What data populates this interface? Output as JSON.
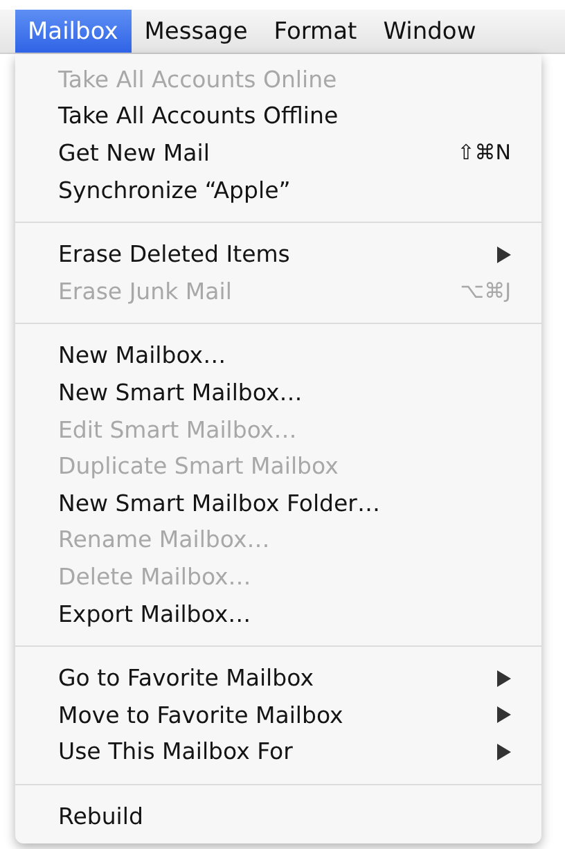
{
  "menubar": [
    {
      "label": "Mailbox",
      "selected": true
    },
    {
      "label": "Message",
      "selected": false
    },
    {
      "label": "Format",
      "selected": false
    },
    {
      "label": "Window",
      "selected": false
    }
  ],
  "menu": {
    "groups": [
      [
        {
          "label": "Take All Accounts Online",
          "disabled": true,
          "submenu": false
        },
        {
          "label": "Take All Accounts Offline",
          "disabled": false,
          "submenu": false
        },
        {
          "label": "Get New Mail",
          "disabled": false,
          "submenu": false,
          "shortcut": "⇧⌘N"
        },
        {
          "label": "Synchronize “Apple”",
          "disabled": false,
          "submenu": false
        }
      ],
      [
        {
          "label": "Erase Deleted Items",
          "disabled": false,
          "submenu": true
        },
        {
          "label": "Erase Junk Mail",
          "disabled": true,
          "submenu": false,
          "shortcut": "⌥⌘J"
        }
      ],
      [
        {
          "label": "New Mailbox…",
          "disabled": false,
          "submenu": false
        },
        {
          "label": "New Smart Mailbox…",
          "disabled": false,
          "submenu": false
        },
        {
          "label": "Edit Smart Mailbox…",
          "disabled": true,
          "submenu": false
        },
        {
          "label": "Duplicate Smart Mailbox",
          "disabled": true,
          "submenu": false
        },
        {
          "label": "New Smart Mailbox Folder…",
          "disabled": false,
          "submenu": false
        },
        {
          "label": "Rename Mailbox…",
          "disabled": true,
          "submenu": false
        },
        {
          "label": "Delete Mailbox…",
          "disabled": true,
          "submenu": false
        },
        {
          "label": "Export Mailbox…",
          "disabled": false,
          "submenu": false
        }
      ],
      [
        {
          "label": "Go to Favorite Mailbox",
          "disabled": false,
          "submenu": true
        },
        {
          "label": "Move to Favorite Mailbox",
          "disabled": false,
          "submenu": true
        },
        {
          "label": "Use This Mailbox For",
          "disabled": false,
          "submenu": true
        }
      ],
      [
        {
          "label": "Rebuild",
          "disabled": false,
          "submenu": false
        }
      ]
    ]
  }
}
